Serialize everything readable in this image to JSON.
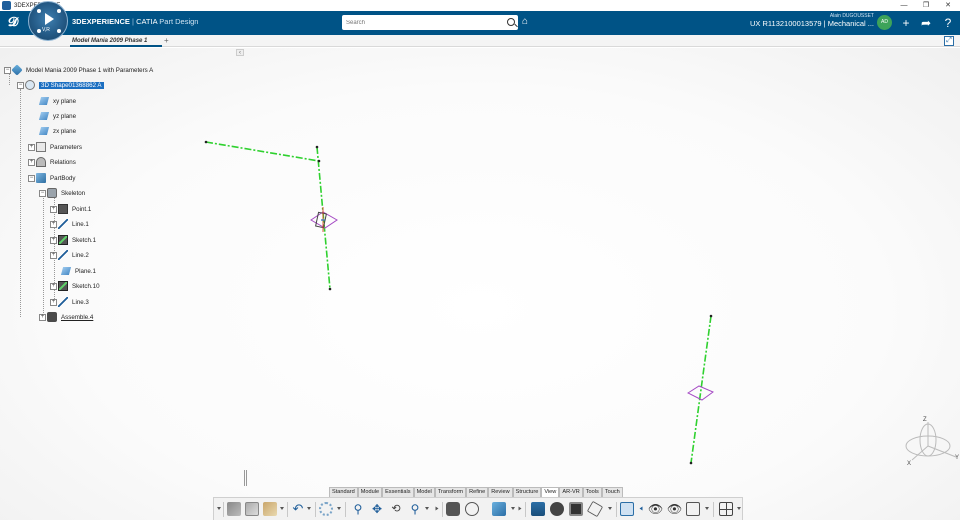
{
  "window": {
    "title": "3DEXPERIENCE",
    "minimize": "—",
    "restore": "❐",
    "close": "✕"
  },
  "header": {
    "brand_strong": "3DEXPERIENCE",
    "brand_sep": " | ",
    "brand_app": "CATIA",
    "brand_role": " Part Design",
    "compass_label": "V,R",
    "search_placeholder": "Search",
    "user_name": "Alain DUGOUSSET",
    "context": "UX R1132100013579 | Mechanical ...",
    "avatar_initials": "AD"
  },
  "tabs": [
    {
      "label": "Model Mania 2009 Phase 1"
    }
  ],
  "tab_add": "+",
  "tree": {
    "root": "Model Mania 2009 Phase 1 with Parameters A",
    "shape": "3D Shape01368862 A",
    "items": [
      {
        "label": "xy plane",
        "icon": "plane-icon"
      },
      {
        "label": "yz plane",
        "icon": "plane-icon"
      },
      {
        "label": "zx plane",
        "icon": "plane-icon"
      },
      {
        "label": "Parameters",
        "icon": "parameters-icon"
      },
      {
        "label": "Relations",
        "icon": "relations-icon"
      },
      {
        "label": "PartBody",
        "icon": "partbody-icon"
      },
      {
        "label": "Skeleton",
        "icon": "skeleton-icon"
      },
      {
        "label": "Point.1",
        "icon": "point-icon"
      },
      {
        "label": "Line.1",
        "icon": "line-icon"
      },
      {
        "label": "Sketch.1",
        "icon": "sketch-icon"
      },
      {
        "label": "Line.2",
        "icon": "line-icon"
      },
      {
        "label": "Plane.1",
        "icon": "plane-icon"
      },
      {
        "label": "Sketch.10",
        "icon": "sketch-icon"
      },
      {
        "label": "Line.3",
        "icon": "line-icon"
      },
      {
        "label": "Assemble.4",
        "icon": "assemble-icon"
      }
    ]
  },
  "workbench_tabs": [
    "Standard",
    "Module",
    "Essentials",
    "Model",
    "Transform",
    "Refine",
    "Review",
    "Structure",
    "View",
    "AR-VR",
    "Tools",
    "Touch"
  ],
  "active_workbench": "View",
  "axis": {
    "z": "Z",
    "x": "X",
    "y": "Y"
  },
  "colors": {
    "topbar": "#005386",
    "selection": "#1c6fc1",
    "geometry_line": "#2fd12f",
    "plane_outline": "#a54ac4"
  }
}
